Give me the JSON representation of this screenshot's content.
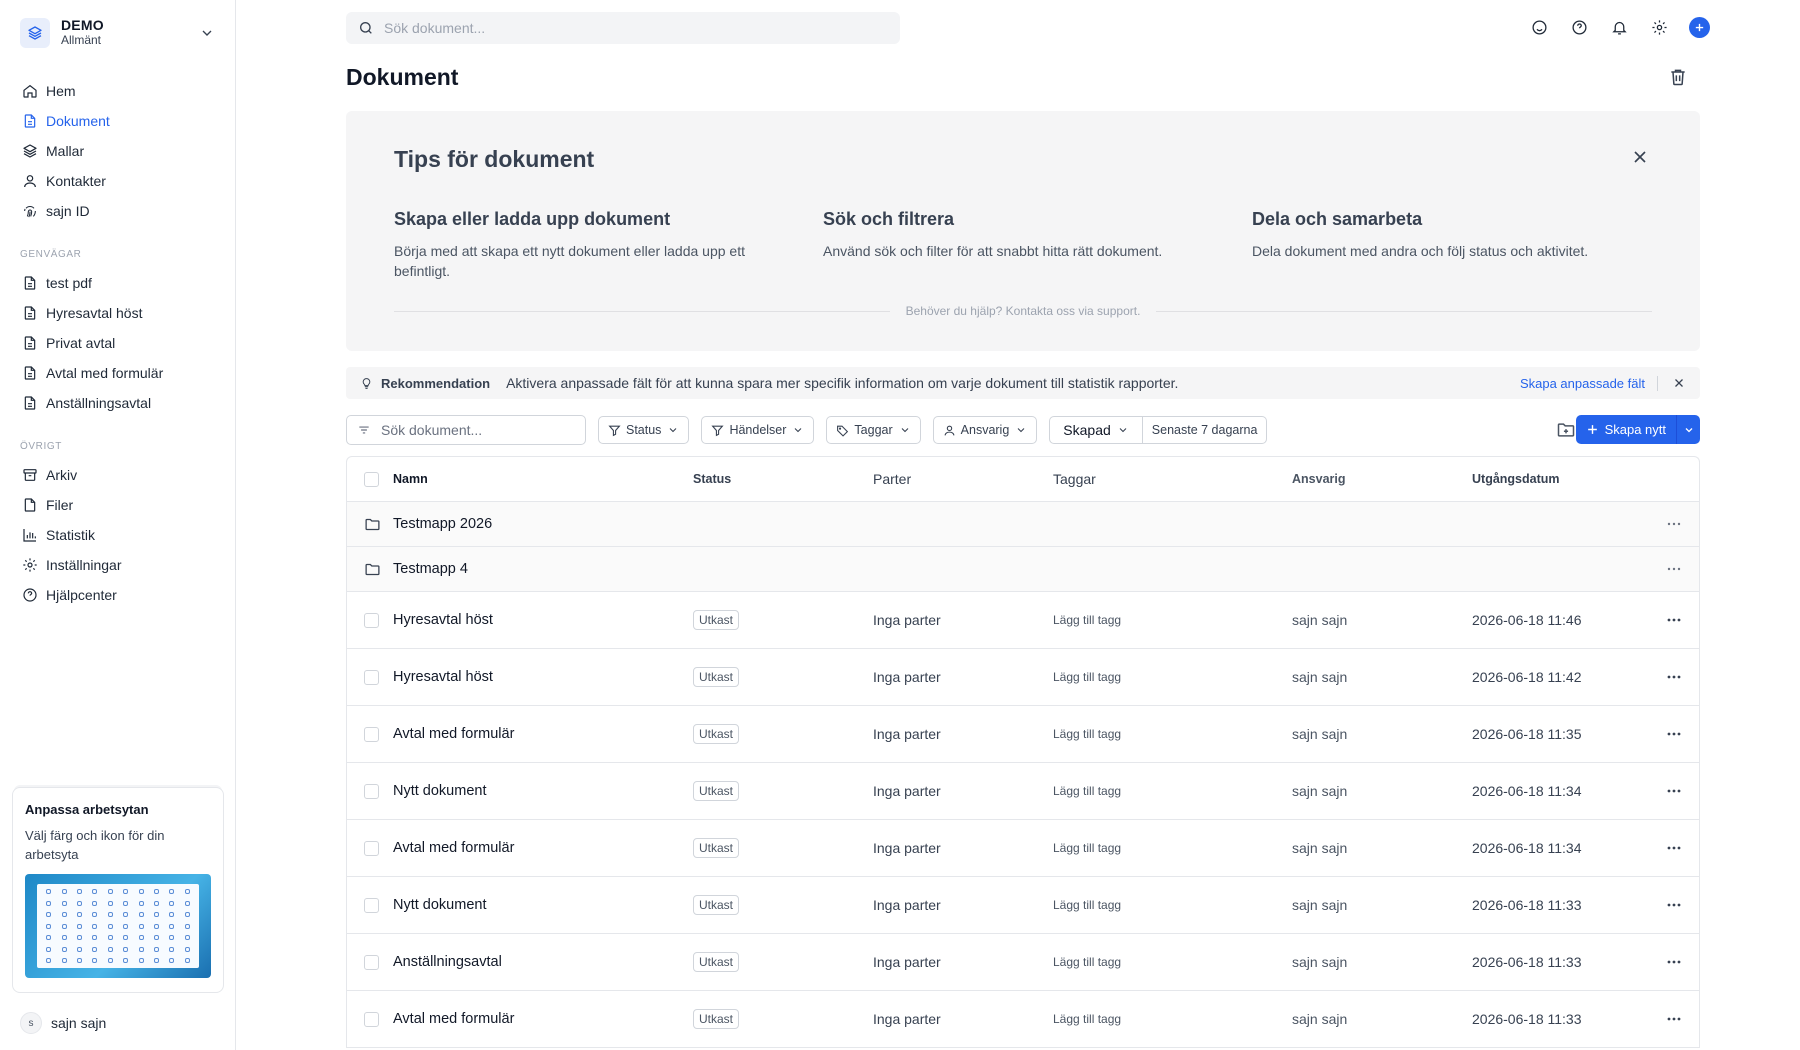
{
  "workspace": {
    "name": "DEMO",
    "subtitle": "Allmänt"
  },
  "nav": [
    {
      "label": "Hem",
      "icon": "home-icon"
    },
    {
      "label": "Dokument",
      "icon": "document-icon",
      "active": true
    },
    {
      "label": "Mallar",
      "icon": "layers-icon"
    },
    {
      "label": "Kontakter",
      "icon": "user-icon"
    },
    {
      "label": "sajn ID",
      "icon": "fingerprint-icon"
    }
  ],
  "shortcuts": {
    "title": "GENVÄGAR",
    "items": [
      "test pdf",
      "Hyresavtal höst",
      "Privat avtal",
      "Avtal med formulär",
      "Anställningsavtal"
    ]
  },
  "other": {
    "title": "ÖVRIGT",
    "items": [
      {
        "label": "Arkiv",
        "icon": "archive-icon"
      },
      {
        "label": "Filer",
        "icon": "file-icon"
      },
      {
        "label": "Statistik",
        "icon": "chart-icon"
      },
      {
        "label": "Inställningar",
        "icon": "gear-icon"
      },
      {
        "label": "Hjälpcenter",
        "icon": "help-icon"
      }
    ]
  },
  "promo": {
    "title": "Anpassa arbetsytan",
    "text": "Välj färg och ikon för din arbetsyta"
  },
  "user": {
    "initial": "s",
    "name": "sajn sajn"
  },
  "top_search": {
    "placeholder": "Sök dokument..."
  },
  "page": {
    "title": "Dokument"
  },
  "tips": {
    "title": "Tips för dokument",
    "columns": [
      {
        "title": "Skapa eller ladda upp dokument",
        "text": "Börja med att skapa ett nytt dokument eller ladda upp ett befintligt."
      },
      {
        "title": "Sök och filtrera",
        "text": "Använd sök och filter för att snabbt hitta rätt dokument."
      },
      {
        "title": "Dela och samarbeta",
        "text": "Dela dokument med andra och följ status och aktivitet."
      }
    ],
    "help": "Behöver du hjälp? Kontakta oss via support."
  },
  "recommendation": {
    "label": "Rekommendation",
    "message": "Aktivera anpassade fält för att kunna spara mer specifik information om varje dokument till statistik rapporter.",
    "link": "Skapa anpassade fält"
  },
  "filters": {
    "search_placeholder": "Sök dokument...",
    "status": "Status",
    "events": "Händelser",
    "tags": "Taggar",
    "owner": "Ansvarig",
    "created": "Skapad",
    "range": "Senaste 7 dagarna",
    "create": "Skapa nytt"
  },
  "table": {
    "headers": {
      "name": "Namn",
      "status": "Status",
      "parties": "Parter",
      "tags": "Taggar",
      "owner": "Ansvarig",
      "expiry": "Utgångsdatum"
    },
    "folders": [
      "Testmapp 2026",
      "Testmapp 4"
    ],
    "rows": [
      {
        "name": "Hyresavtal höst",
        "status": "Utkast",
        "parties": "Inga parter",
        "tags": "Lägg till tagg",
        "owner": "sajn sajn",
        "date": "2026-06-18 11:46"
      },
      {
        "name": "Hyresavtal höst",
        "status": "Utkast",
        "parties": "Inga parter",
        "tags": "Lägg till tagg",
        "owner": "sajn sajn",
        "date": "2026-06-18 11:42"
      },
      {
        "name": "Avtal med formulär",
        "status": "Utkast",
        "parties": "Inga parter",
        "tags": "Lägg till tagg",
        "owner": "sajn sajn",
        "date": "2026-06-18 11:35"
      },
      {
        "name": "Nytt dokument",
        "status": "Utkast",
        "parties": "Inga parter",
        "tags": "Lägg till tagg",
        "owner": "sajn sajn",
        "date": "2026-06-18 11:34"
      },
      {
        "name": "Avtal med formulär",
        "status": "Utkast",
        "parties": "Inga parter",
        "tags": "Lägg till tagg",
        "owner": "sajn sajn",
        "date": "2026-06-18 11:34"
      },
      {
        "name": "Nytt dokument",
        "status": "Utkast",
        "parties": "Inga parter",
        "tags": "Lägg till tagg",
        "owner": "sajn sajn",
        "date": "2026-06-18 11:33"
      },
      {
        "name": "Anställningsavtal",
        "status": "Utkast",
        "parties": "Inga parter",
        "tags": "Lägg till tagg",
        "owner": "sajn sajn",
        "date": "2026-06-18 11:33"
      },
      {
        "name": "Avtal med formulär",
        "status": "Utkast",
        "parties": "Inga parter",
        "tags": "Lägg till tagg",
        "owner": "sajn sajn",
        "date": "2026-06-18 11:33"
      }
    ]
  },
  "colors": {
    "accent": "#2563eb"
  }
}
